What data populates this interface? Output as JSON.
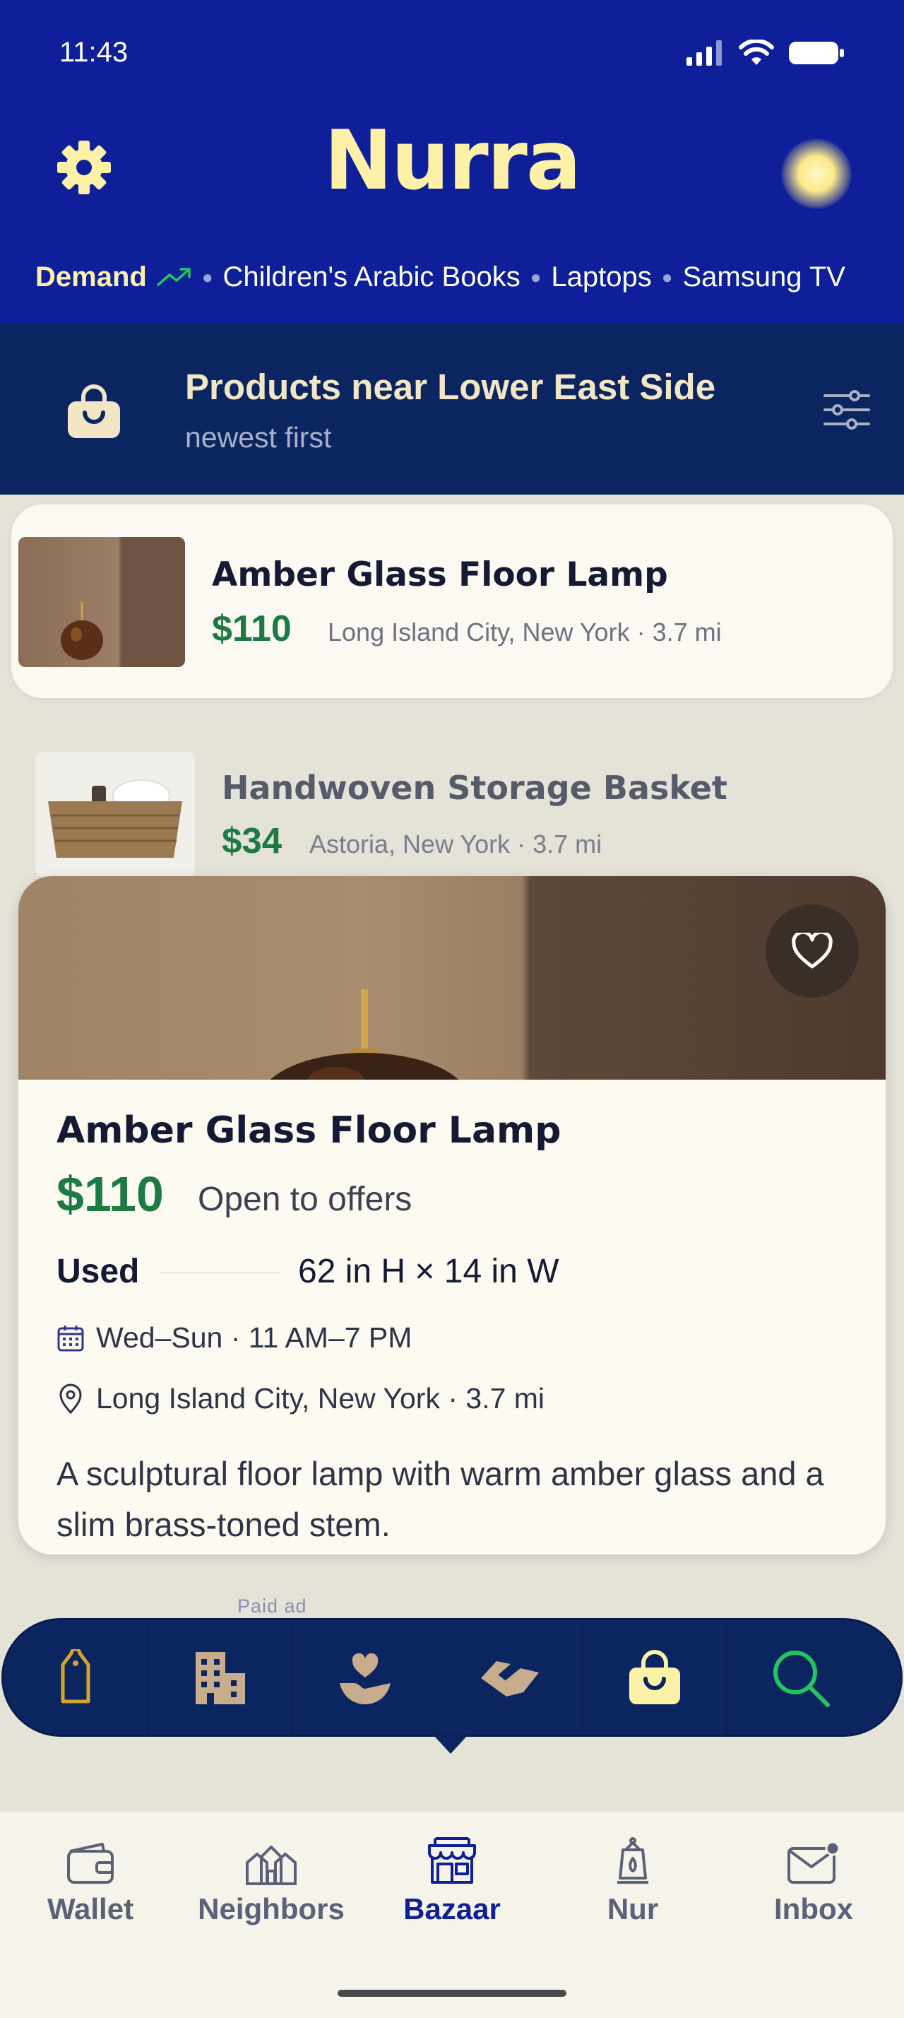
{
  "status_bar": {
    "time": "11:43"
  },
  "header": {
    "app_name": "Nurra",
    "demand": {
      "label": "Demand",
      "items": [
        "Children's Arabic Books",
        "Laptops",
        "Samsung TV"
      ]
    }
  },
  "listing_header": {
    "title": "Products near Lower East Side",
    "subtitle": "newest first"
  },
  "products": [
    {
      "title": "Amber Glass Floor Lamp",
      "price": "$110",
      "location": "Long Island City, New York · 3.7 mi"
    },
    {
      "title": "Handwoven Storage Basket",
      "price": "$34",
      "location": "Astoria, New York · 3.7 mi"
    }
  ],
  "detail": {
    "title": "Amber Glass Floor Lamp",
    "price": "$110",
    "offers": "Open to offers",
    "condition": "Used",
    "dimensions": "62 in H × 14 in W",
    "hours": "Wed–Sun · 11 AM–7 PM",
    "location": "Long Island City, New York · 3.7 mi",
    "description": "A sculptural floor lamp with warm amber glass and a slim brass-toned stem."
  },
  "paid_ad_label": "Paid ad",
  "quick_actions": [
    "tag-icon",
    "building-icon",
    "heart-hand-icon",
    "handshake-icon",
    "shopping-bag-icon",
    "search-icon"
  ],
  "tabs": [
    {
      "label": "Wallet",
      "icon": "wallet-icon"
    },
    {
      "label": "Neighbors",
      "icon": "neighbors-icon"
    },
    {
      "label": "Bazaar",
      "icon": "store-icon",
      "active": true
    },
    {
      "label": "Nur",
      "icon": "lantern-icon"
    },
    {
      "label": "Inbox",
      "icon": "mail-icon"
    }
  ],
  "colors": {
    "header_bg": "#0e1f99",
    "banner_bg": "#0b2560",
    "brand_yellow": "#fdf1a8",
    "price_green": "#1d7a42",
    "page_bg": "#e5e2d8"
  }
}
